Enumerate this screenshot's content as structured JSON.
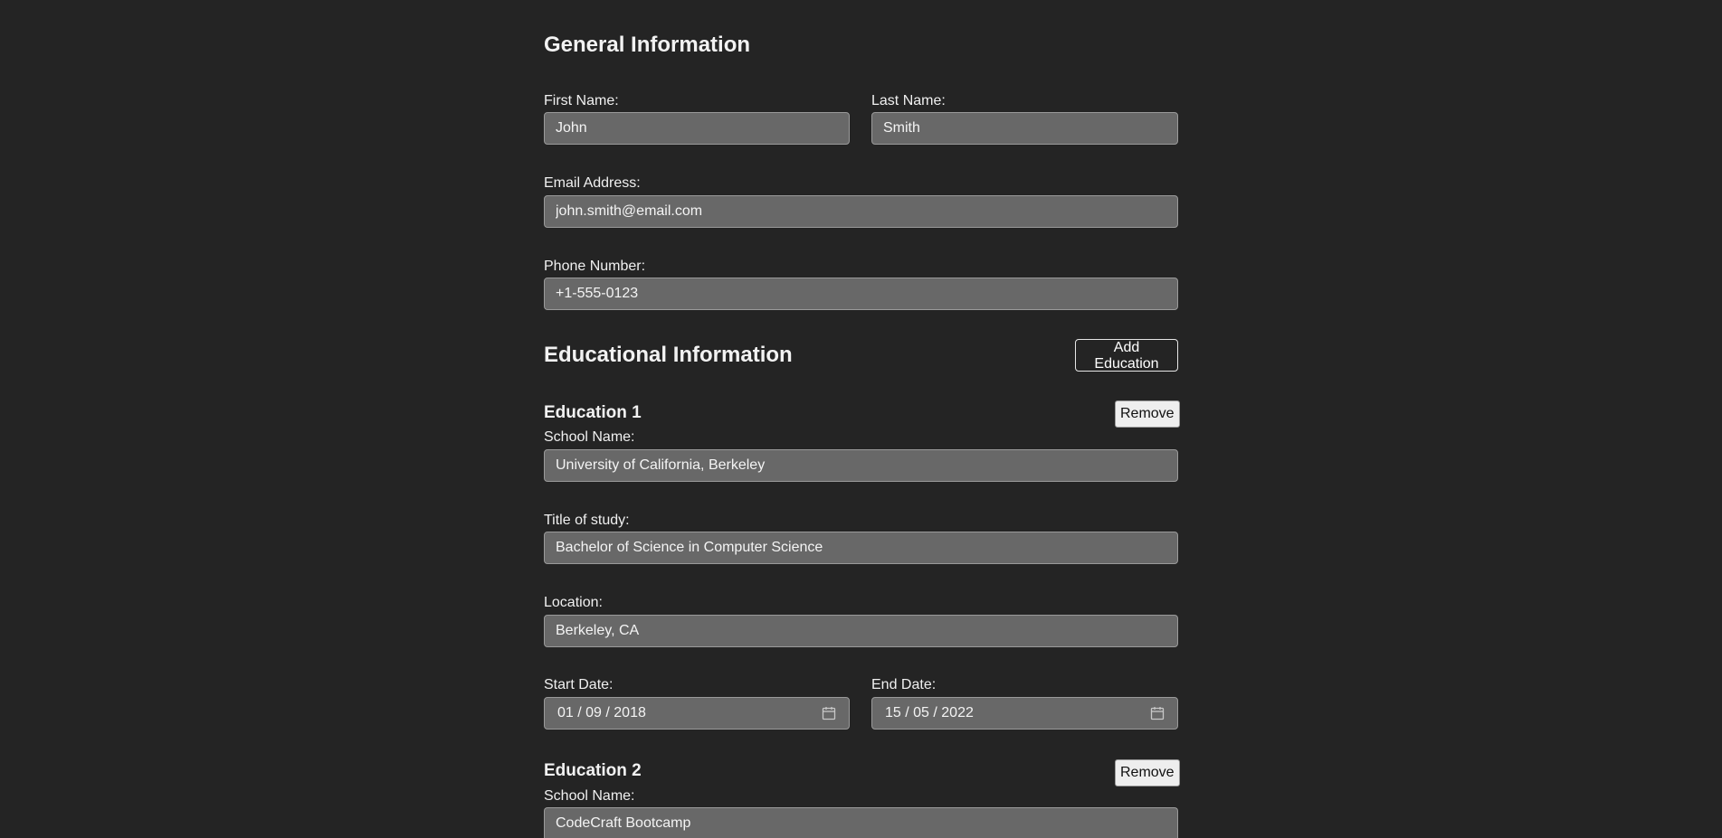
{
  "general": {
    "title": "General Information",
    "first_name_label": "First Name:",
    "first_name_value": "John",
    "last_name_label": "Last Name:",
    "last_name_value": "Smith",
    "email_label": "Email Address:",
    "email_value": "john.smith@email.com",
    "phone_label": "Phone Number:",
    "phone_value": "+1-555-0123"
  },
  "education": {
    "title": "Educational Information",
    "add_label": "Add Education",
    "entries": [
      {
        "title": "Education 1",
        "remove_label": "Remove",
        "school_label": "School Name:",
        "school_value": "University of California, Berkeley",
        "study_label": "Title of study:",
        "study_value": "Bachelor of Science in Computer Science",
        "location_label": "Location:",
        "location_value": "Berkeley, CA",
        "start_label": "Start Date:",
        "start_value": "01 / 09 / 2018",
        "end_label": "End Date:",
        "end_value": "15 / 05 / 2022"
      },
      {
        "title": "Education 2",
        "remove_label": "Remove",
        "school_label": "School Name:",
        "school_value": "CodeCraft Bootcamp"
      }
    ]
  },
  "icons": {
    "date_picker": "calendar-icon"
  },
  "colors": {
    "background": "#242424",
    "input_background": "#686868",
    "text": "#ffffff"
  }
}
